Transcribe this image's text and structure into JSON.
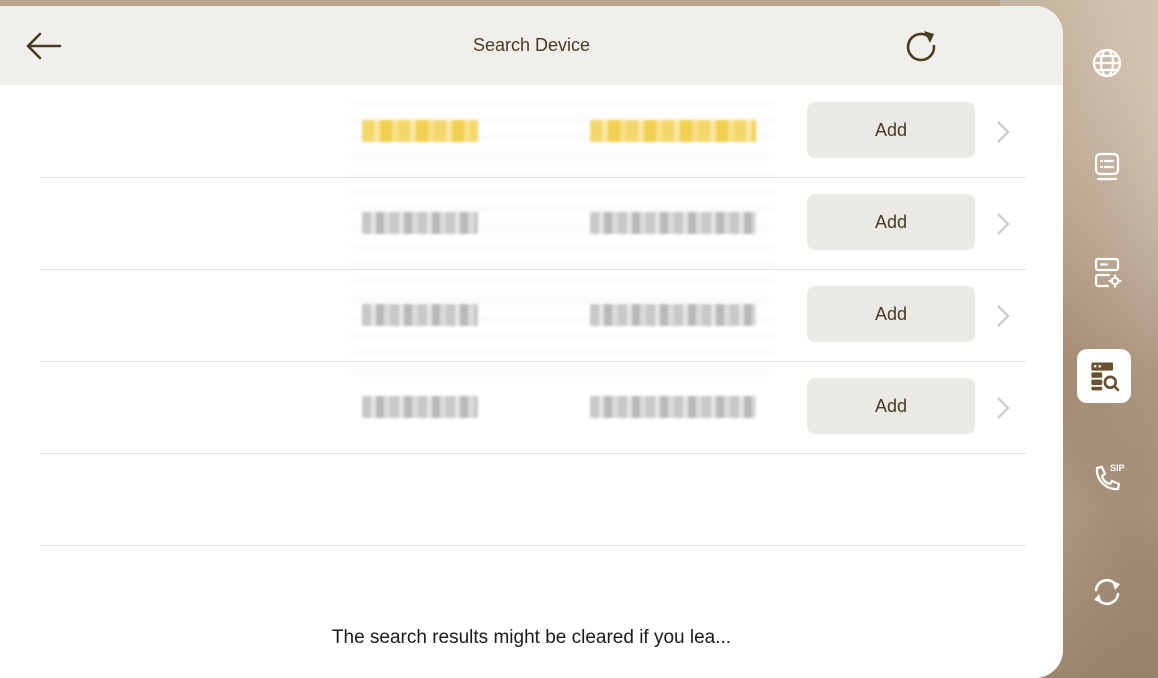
{
  "header": {
    "title": "Search Device"
  },
  "devices": [
    {
      "add_label": "Add",
      "highlighted": true
    },
    {
      "add_label": "Add",
      "highlighted": false
    },
    {
      "add_label": "Add",
      "highlighted": false
    },
    {
      "add_label": "Add",
      "highlighted": false
    }
  ],
  "notice": "The search results might be cleared if you lea...",
  "sidebar": {
    "items": [
      {
        "icon": "globe-icon",
        "active": false
      },
      {
        "icon": "list-icon",
        "active": false
      },
      {
        "icon": "device-settings-icon",
        "active": false
      },
      {
        "icon": "device-search-icon",
        "active": true
      },
      {
        "icon": "sip-phone-icon",
        "label": "SIP",
        "active": false
      },
      {
        "icon": "sync-icon",
        "active": false
      }
    ]
  },
  "colors": {
    "accent": "#4a3a1f",
    "header_bg": "#f1efec",
    "button_bg": "#ebe9e6",
    "highlight": "#f5d86a"
  }
}
